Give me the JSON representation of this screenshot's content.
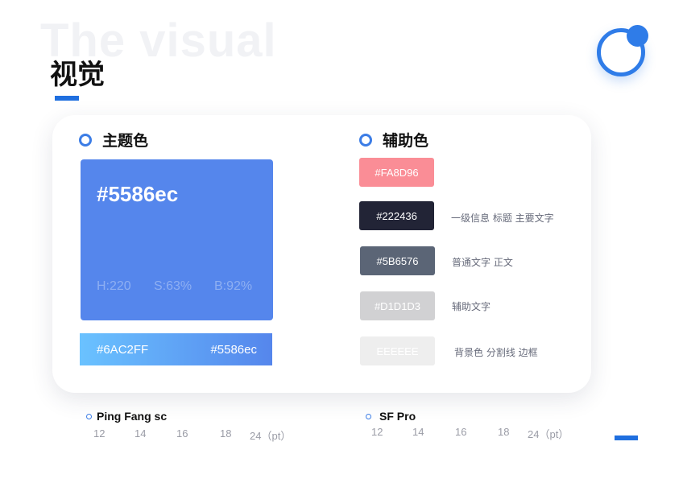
{
  "header": {
    "bg_title": "The visual",
    "title": "视觉"
  },
  "primary": {
    "heading": "主题色",
    "hex": "#5586ec",
    "h": "H:220",
    "s": "S:63%",
    "b": "B:92%",
    "gradient_start": "#6AC2FF",
    "gradient_end": "#5586ec"
  },
  "secondary": {
    "heading": "辅助色",
    "swatches": [
      {
        "hex": "#FA8D96",
        "usage": ""
      },
      {
        "hex": "#222436",
        "usage": "一级信息 标题 主要文字"
      },
      {
        "hex": "#5B6576",
        "usage": "普通文字   正文"
      },
      {
        "hex": "#D1D1D3",
        "usage": "辅助文字"
      },
      {
        "hex": "EEEEEE",
        "usage": "背景色  分割线 边框"
      }
    ]
  },
  "fonts": [
    {
      "name": "Ping Fang sc",
      "sizes": [
        "12",
        "14",
        "16",
        "18",
        "24（pt）"
      ]
    },
    {
      "name": "SF Pro",
      "sizes": [
        "12",
        "14",
        "16",
        "18",
        "24（pt）"
      ]
    }
  ],
  "colors": {
    "accent": "#2f7ce8",
    "primary": "#5586ec",
    "gradient_start": "#6AC2FF",
    "swatch_1": "#FA8D96",
    "swatch_2": "#222436",
    "swatch_3": "#5B6576",
    "swatch_4": "#D1D1D3",
    "swatch_5": "#EEEEEE"
  }
}
